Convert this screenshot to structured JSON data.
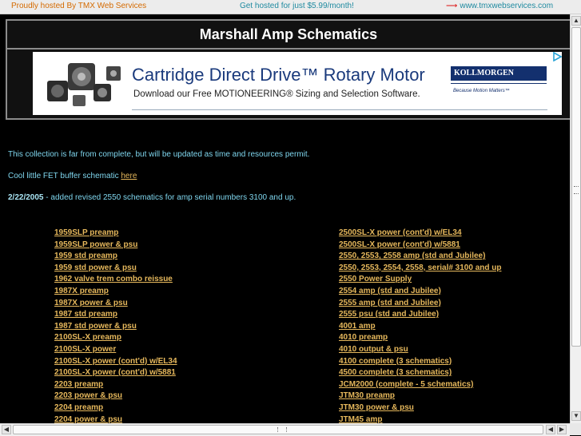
{
  "hostbar": {
    "left_text": "Proudly hosted By TMX Web Services",
    "center_text": "Get hosted for just $5.99/month!",
    "right_text": "www.tmxwebservices.com"
  },
  "header": {
    "title": "Marshall Amp Schematics"
  },
  "ad": {
    "headline": "Cartridge Direct Drive™ Rotary Motor",
    "subline": "Download our Free MOTIONEERING® Sizing and Selection Software.",
    "brand": "KOLLMORGEN",
    "tagline": "Because Motion Matters™"
  },
  "intro": {
    "line1": "This collection is far from complete, but will be updated as time and resources permit.",
    "line2_prefix": "Cool little FET buffer schematic ",
    "line2_link": "here",
    "update_date": "2/22/2005",
    "update_text": " - added revised 2550 schematics for amp serial numbers 3100 and up."
  },
  "links": {
    "column1": [
      "1959SLP preamp",
      "1959SLP power & psu",
      "1959 std preamp",
      "1959 std power & psu",
      "1962 valve trem combo reissue",
      "1987X preamp",
      "1987X power & psu",
      "1987 std preamp",
      "1987 std power & psu",
      "2100SL-X preamp",
      "2100SL-X power",
      "2100SL-X power (cont'd) w/EL34",
      "2100SL-X power (cont'd) w/5881",
      "2203 preamp",
      "2203 power & psu",
      "2204 preamp",
      "2204 power & psu"
    ],
    "column2": [
      "2500SL-X power (cont'd) w/EL34",
      "2500SL-X power (cont'd) w/5881",
      "2550, 2553, 2558 amp (std and Jubilee)",
      "2550, 2553, 2554, 2558, serial# 3100 and up",
      "2550 Power Supply",
      "2554 amp (std and Jubilee)",
      "2555 amp (std and Jubilee)",
      "2555 psu (std and Jubilee)",
      "4001 amp",
      "4010 preamp",
      "4010 output & psu",
      "4100 complete (3 schematics)",
      "4500 complete (3 schematics)",
      "JCM2000 (complete - 5 schematics)",
      "JTM30 preamp",
      "JTM30 power & psu",
      "JTM45 amp"
    ]
  }
}
